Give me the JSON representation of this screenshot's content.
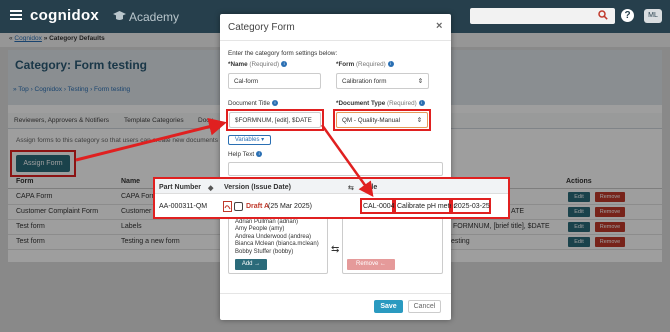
{
  "header": {
    "brand": "cognidox",
    "academy": "Academy",
    "help": "?",
    "avatar": "ML"
  },
  "breadcrumb": {
    "prefix": "« ",
    "link": "Cognidox",
    "current": " » Category Defaults"
  },
  "page": {
    "title": "Category: Form testing",
    "crumbs": "» Top › Cognidox › Testing › Form testing"
  },
  "tabs": [
    "Reviewers, Approvers & Notifiers",
    "Template Categories",
    "Docu"
  ],
  "assign": {
    "text": "Assign forms to this category so that users can create new documents ba",
    "button": "Assign Form"
  },
  "table": {
    "headers": {
      "form": "Form",
      "name": "Name",
      "actions": "Actions"
    },
    "rows": [
      {
        "form": "CAPA Form",
        "name": "CAPA Form",
        "extra": ""
      },
      {
        "form": "Customer Complaint Form",
        "name": "Customer",
        "extra": "ATE"
      },
      {
        "form": "Test form",
        "name": "Labels",
        "extra": "FORMNUM, [brief title], $DATE"
      },
      {
        "form": "Test form",
        "name": "Testing a new form",
        "extra": "esting"
      }
    ],
    "edit_label": "Edit",
    "remove_label": "Remove"
  },
  "modal": {
    "title": "Category Form",
    "close": "×",
    "intro": "Enter the category form settings below:",
    "name_label": "*Name",
    "name_req": "(Required)",
    "name_value": "Cal-form",
    "form_label": "*Form",
    "form_req": "(Required)",
    "form_value": "Calibration form",
    "doc_title_label": "Document Title",
    "doc_title_value": "$FORMNUM, [edit], $DATE",
    "doc_type_label": "*Document Type",
    "doc_type_req": "(Required)",
    "doc_type_value": "QM - Quality-Manual",
    "variables": "Variables ▾",
    "help_text_label": "Help Text",
    "users": [
      "Adrian Pullman (adrian)",
      "Amy People (amy)",
      "Andrea Underwood (andrea)",
      "Bianca Mclean (bianca.mclean)",
      "Bobby Stuffer (bobby)"
    ],
    "add": "Add →",
    "remove": "Remove ←",
    "save": "Save",
    "cancel": "Cancel"
  },
  "overlay_table": {
    "headers": {
      "part": "Part Number",
      "version": "Version (Issue Date)",
      "title": "Title"
    },
    "part_number": "AA-000311-QM",
    "draft": "Draft A",
    "draft_date": " (25 Mar 2025)",
    "title_num": "CAL-0004",
    "title_brief": "Calibrate pH meter",
    "title_date": "2025-03-25"
  },
  "colors": {
    "topbar": "#263f4c",
    "accent": "#2b6b7a",
    "annotation": "#e02020",
    "remove": "#c0392b",
    "save": "#2a9ac0"
  }
}
